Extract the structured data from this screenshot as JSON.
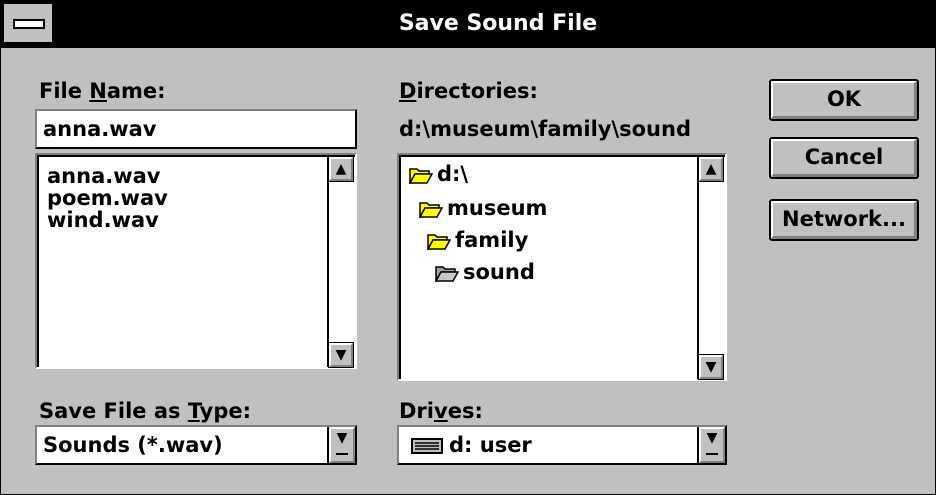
{
  "window": {
    "title": "Save Sound File"
  },
  "file_name": {
    "label_pre": "File ",
    "label_ul": "N",
    "label_post": "ame:",
    "value": "anna.wav",
    "files": [
      "anna.wav",
      "poem.wav",
      "wind.wav"
    ]
  },
  "directories": {
    "label_ul": "D",
    "label_post": "irectories:",
    "current_path": "d:\\museum\\family\\sound",
    "tree": [
      "d:\\",
      "museum",
      "family",
      "sound"
    ]
  },
  "save_type": {
    "label_pre": "Save File as ",
    "label_ul": "T",
    "label_post": "ype:",
    "selected": "Sounds (*.wav)"
  },
  "drives": {
    "label_pre": "Dri",
    "label_ul": "v",
    "label_post": "es:",
    "selected": "d: user"
  },
  "buttons": {
    "ok": "OK",
    "cancel": "Cancel",
    "network": "Network..."
  },
  "icons": {
    "system_menu": "system-menu-icon",
    "folder_open": "folder-open-icon",
    "drive": "drive-icon",
    "scroll_up": "up-arrow-icon",
    "scroll_down": "down-arrow-icon",
    "dropdown": "dropdown-arrow-icon"
  },
  "colors": {
    "dialog_bg": "#c0c0c0",
    "titlebar_bg": "#000000",
    "folder_fill": "#ffff00"
  }
}
